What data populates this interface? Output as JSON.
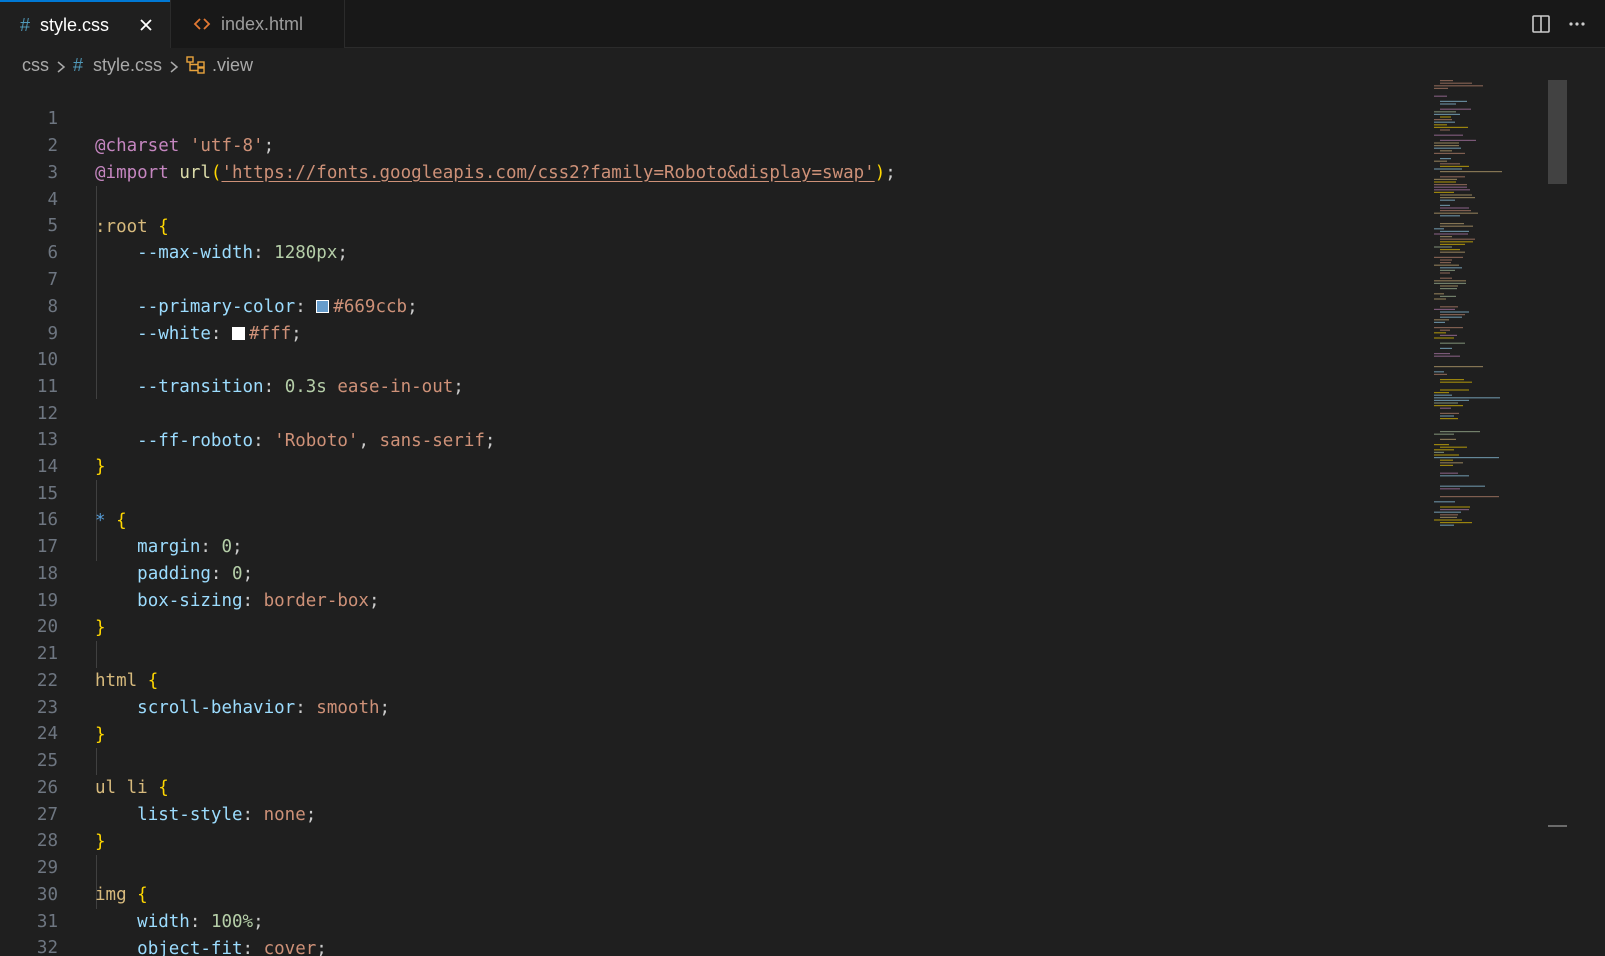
{
  "tabs": [
    {
      "label": "style.css",
      "icon": "css-hash-icon",
      "active": true
    },
    {
      "label": "index.html",
      "icon": "html-code-icon",
      "active": false
    }
  ],
  "breadcrumb": {
    "folder": "css",
    "file": "style.css",
    "symbol": ".view"
  },
  "colors": {
    "accent": "#0078d4",
    "primary_swatch": "#669ccb",
    "white_swatch": "#fff"
  },
  "line_numbers": [
    "1",
    "2",
    "3",
    "4",
    "5",
    "6",
    "7",
    "8",
    "9",
    "10",
    "11",
    "12",
    "13",
    "14",
    "15",
    "16",
    "17",
    "18",
    "19",
    "20",
    "21",
    "22",
    "23",
    "24",
    "25",
    "26",
    "27",
    "28",
    "29",
    "30",
    "31",
    "32"
  ],
  "code": {
    "l1": {
      "at": "@charset",
      "str": "'utf-8'",
      "semi": ";"
    },
    "l2": {
      "at": "@import",
      "fn": "url",
      "open": "(",
      "url": "'https://fonts.googleapis.com/css2?family=Roboto&display=swap'",
      "close": ")",
      "semi": ";"
    },
    "l4": {
      "sel": ":root",
      "brace": "{"
    },
    "l5": {
      "prop": "--max-width",
      "colon": ":",
      "val": "1280px",
      "semi": ";"
    },
    "l7": {
      "prop": "--primary-color",
      "colon": ":",
      "val": "#669ccb",
      "semi": ";"
    },
    "l8": {
      "prop": "--white",
      "colon": ":",
      "val": "#fff",
      "semi": ";"
    },
    "l10": {
      "prop": "--transition",
      "colon": ":",
      "num": "0.3s",
      "val": "ease-in-out",
      "semi": ";"
    },
    "l12": {
      "prop": "--ff-roboto",
      "colon": ":",
      "str": "'Roboto'",
      "comma": ",",
      "val": "sans-serif",
      "semi": ";"
    },
    "l13": {
      "brace": "}"
    },
    "l15": {
      "sel": "*",
      "brace": "{"
    },
    "l16": {
      "prop": "margin",
      "colon": ":",
      "num": "0",
      "semi": ";"
    },
    "l17": {
      "prop": "padding",
      "colon": ":",
      "num": "0",
      "semi": ";"
    },
    "l18": {
      "prop": "box-sizing",
      "colon": ":",
      "val": "border-box",
      "semi": ";"
    },
    "l19": {
      "brace": "}"
    },
    "l21": {
      "sel": "html",
      "brace": "{"
    },
    "l22": {
      "prop": "scroll-behavior",
      "colon": ":",
      "val": "smooth",
      "semi": ";"
    },
    "l23": {
      "brace": "}"
    },
    "l25": {
      "sel": "ul li",
      "brace": "{"
    },
    "l26": {
      "prop": "list-style",
      "colon": ":",
      "val": "none",
      "semi": ";"
    },
    "l27": {
      "brace": "}"
    },
    "l29": {
      "sel": "img",
      "brace": "{"
    },
    "l30": {
      "prop": "width",
      "colon": ":",
      "num": "100%",
      "semi": ";"
    },
    "l31": {
      "prop": "object-fit",
      "colon": ":",
      "val": "cover",
      "semi": ";"
    },
    "l32": {
      "brace": "}"
    }
  }
}
